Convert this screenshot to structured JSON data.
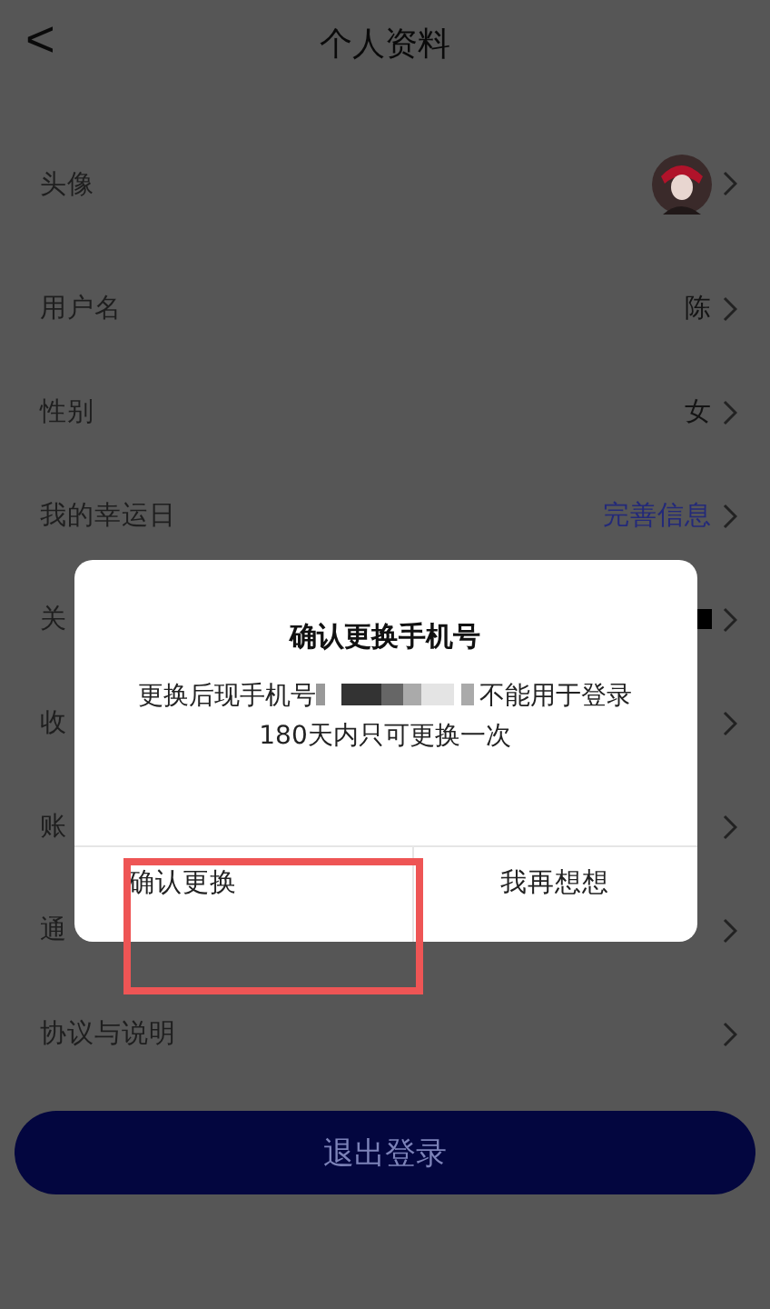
{
  "header": {
    "back": "<",
    "title": "个人资料"
  },
  "rows": [
    {
      "label": "头像",
      "kind": "avatar"
    },
    {
      "label": "用户名",
      "kind": "text",
      "value": "陈"
    },
    {
      "label": "性别",
      "kind": "text",
      "value": "女"
    },
    {
      "label": "我的幸运日",
      "kind": "link",
      "value": "完善信息"
    },
    {
      "label": "关",
      "kind": "redacted"
    },
    {
      "label": "收",
      "kind": "plain"
    },
    {
      "label": "账",
      "kind": "plain"
    },
    {
      "label": "通",
      "kind": "plain"
    },
    {
      "label": "协议与说明",
      "kind": "plain"
    }
  ],
  "logout": "退出登录",
  "dialog": {
    "title": "确认更换手机号",
    "message_before": "更换后现手机号",
    "message_after": "不能用于登录",
    "note": "180天内只可更换一次",
    "buttons": [
      {
        "label": "确认更换",
        "highlighted": true
      },
      {
        "label": "我再想想",
        "highlighted": false
      }
    ]
  }
}
